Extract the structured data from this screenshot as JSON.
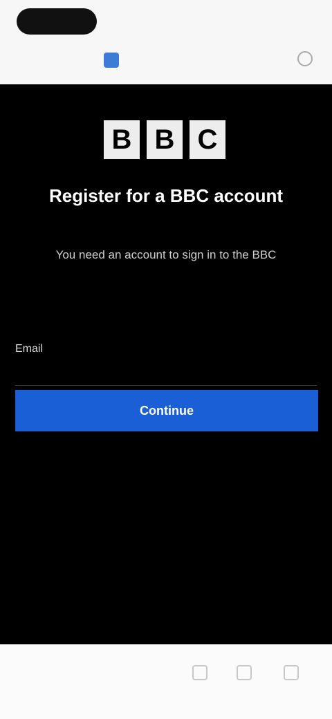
{
  "browser": {
    "tab_title": "",
    "accent_color": "#3d7bd6"
  },
  "brand": {
    "logo_letters": [
      "B",
      "B",
      "C"
    ]
  },
  "signup": {
    "headline": "Register for a BBC account",
    "subtext": "You need an account to sign in to the BBC",
    "email_label": "Email",
    "email_value": "",
    "email_placeholder": "",
    "continue_label": "Continue",
    "terms_text": "",
    "terms_link": "",
    "signin_link": "",
    "button_color": "#1a5fd6"
  }
}
